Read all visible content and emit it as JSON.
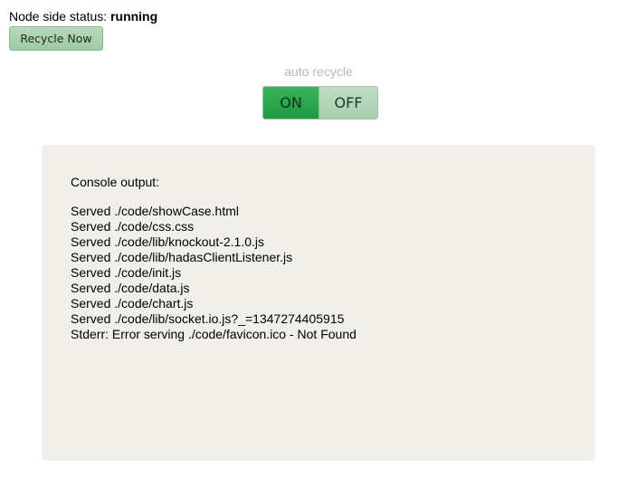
{
  "status": {
    "label": "Node side status: ",
    "value": "running"
  },
  "recycle_button": {
    "label": "Recycle Now"
  },
  "auto_recycle": {
    "label": "auto recycle",
    "on_label": "ON",
    "off_label": "OFF",
    "state": "ON"
  },
  "console": {
    "title": "Console output:",
    "lines": [
      "Served ./code/showCase.html",
      "Served ./code/css.css",
      "Served ./code/lib/knockout-2.1.0.js",
      "Served ./code/lib/hadasClientListener.js",
      "Served ./code/init.js",
      "Served ./code/data.js",
      "Served ./code/chart.js",
      "Served ./code/lib/socket.io.js?_=1347274405915",
      "Stderr: Error serving ./code/favicon.ico - Not Found"
    ]
  },
  "colors": {
    "button_green": "#9ccaa3",
    "toggle_active": "#1d9a3f",
    "toggle_inactive": "#a7cfae",
    "console_bg": "#f0efea",
    "muted_text": "#b8b8b8"
  }
}
